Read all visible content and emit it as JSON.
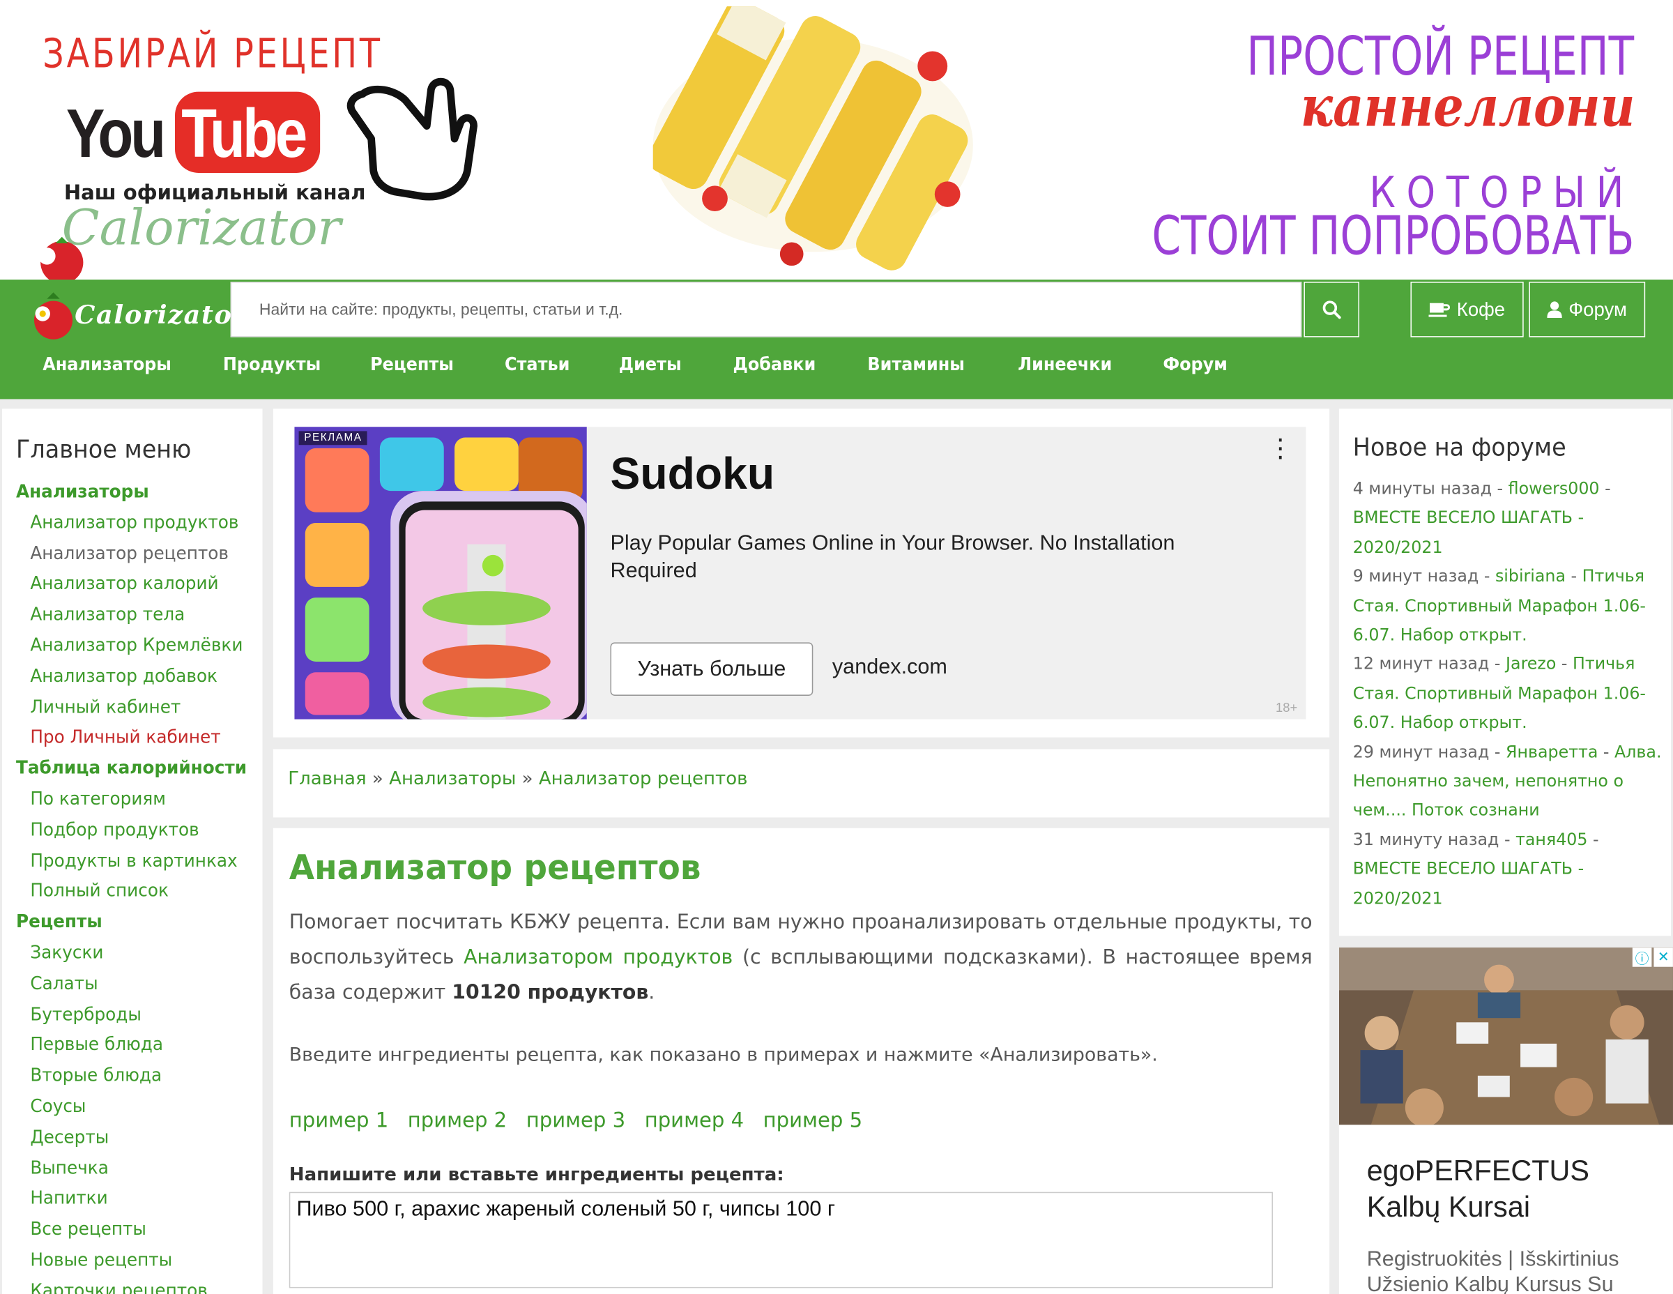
{
  "banner": {
    "left_title": "ЗАБИРАЙ РЕЦЕПТ",
    "yt_you": "You",
    "yt_tube": "Tube",
    "channel_text": "Наш официальный канал",
    "channel_script": "Calorizator",
    "right_line1": "ПРОСТОЙ РЕЦЕПТ",
    "right_line2": "каннеллони",
    "right_line3": "КОТОРЫЙ",
    "right_line4": "СТОИТ ПОПРОБОВАТЬ"
  },
  "header": {
    "logo_text": "Calorizator",
    "search_placeholder": "Найти на сайте: продукты, рецепты, статьи и т.д.",
    "coffee_label": "Кофе",
    "forum_label": "Форум"
  },
  "nav": [
    "Анализаторы",
    "Продукты",
    "Рецепты",
    "Статьи",
    "Диеты",
    "Добавки",
    "Витамины",
    "Линеечки",
    "Форум"
  ],
  "left_menu": {
    "title": "Главное меню",
    "items": [
      {
        "label": "Анализаторы",
        "kind": "cat"
      },
      {
        "label": "Анализатор продуктов",
        "kind": "sub"
      },
      {
        "label": "Анализатор рецептов",
        "kind": "sub-gray"
      },
      {
        "label": "Анализатор калорий",
        "kind": "sub"
      },
      {
        "label": "Анализатор тела",
        "kind": "sub"
      },
      {
        "label": "Анализатор Кремлёвки",
        "kind": "sub"
      },
      {
        "label": "Анализатор добавок",
        "kind": "sub"
      },
      {
        "label": "Личный кабинет",
        "kind": "sub"
      },
      {
        "label": "Про Личный кабинет",
        "kind": "sub-red"
      },
      {
        "label": "Таблица калорийности",
        "kind": "cat"
      },
      {
        "label": "По категориям",
        "kind": "sub"
      },
      {
        "label": "Подбор продуктов",
        "kind": "sub"
      },
      {
        "label": "Продукты в картинках",
        "kind": "sub"
      },
      {
        "label": "Полный список",
        "kind": "sub"
      },
      {
        "label": "Рецепты",
        "kind": "cat"
      },
      {
        "label": "Закуски",
        "kind": "sub"
      },
      {
        "label": "Салаты",
        "kind": "sub"
      },
      {
        "label": "Бутерброды",
        "kind": "sub"
      },
      {
        "label": "Первые блюда",
        "kind": "sub"
      },
      {
        "label": "Вторые блюда",
        "kind": "sub"
      },
      {
        "label": "Соусы",
        "kind": "sub"
      },
      {
        "label": "Десерты",
        "kind": "sub"
      },
      {
        "label": "Выпечка",
        "kind": "sub"
      },
      {
        "label": "Напитки",
        "kind": "sub"
      },
      {
        "label": "Все рецепты",
        "kind": "sub"
      },
      {
        "label": "Новые рецепты",
        "kind": "sub"
      },
      {
        "label": "Карточки рецептов",
        "kind": "sub"
      }
    ]
  },
  "ad": {
    "badge": "РЕКЛАМА",
    "title": "Sudoku",
    "description": "Play Popular Games Online in Your Browser. No Installation Required",
    "button": "Узнать больше",
    "domain": "yandex.com",
    "age": "18+",
    "more": "⋮"
  },
  "breadcrumb": {
    "home": "Главная",
    "sep": " » ",
    "analyzers": "Анализаторы",
    "current": "Анализатор рецептов"
  },
  "main": {
    "title": "Анализатор рецептов",
    "intro_part1": "Помогает посчитать КБЖУ рецепта. Если вам нужно проанализировать отдельные продукты, то воспользуйтесь ",
    "intro_link": "Анализатором продуктов",
    "intro_part2": " (с всплывающими подсказками). В настоящее время база содержит ",
    "intro_count": "10120 продуктов",
    "intro_part3": ".",
    "instructions": "Введите ингредиенты рецепта, как показано в примерах и нажмите «Анализировать».",
    "examples": [
      "пример 1",
      "пример 2",
      "пример 3",
      "пример 4",
      "пример 5"
    ],
    "textarea_label": "Напишите или вставьте ингредиенты рецепта:",
    "textarea_value": "Пиво 500 г, арахис жареный соленый 50 г, чипсы 100 г"
  },
  "forum": {
    "title": "Новое на форуме",
    "entries": [
      {
        "time": "4 минуты назад",
        "user": "flowers000",
        "topic": "ВМЕСТЕ ВЕСЕЛО ШАГАТЬ - 2020/2021"
      },
      {
        "time": "9 минут назад",
        "user": "sibiriana",
        "topic": "Птичья Стая. Спортивный Марафон 1.06-6.07. Набор открыт."
      },
      {
        "time": "12 минут назад",
        "user": "Jarezo",
        "topic": "Птичья Стая. Спортивный Марафон 1.06-6.07. Набор открыт."
      },
      {
        "time": "29 минут назад",
        "user": "Январетта",
        "topic": "Алва. Непонятно зачем, непонятно о чем.... Поток сознани"
      },
      {
        "time": "31 минуту назад",
        "user": "таня405",
        "topic": "ВМЕСТЕ ВЕСЕЛО ШАГАТЬ - 2020/2021"
      }
    ]
  },
  "ad2": {
    "title": "egoPERFECTUS Kalbų Kursai",
    "text": "Registruokitės | Išskirtinius Užsienio Kalbų Kursus Su"
  },
  "colors": {
    "green": "#4fa63b",
    "link_green": "#3d9a2b",
    "red": "#e0322a",
    "purple": "#9b3fd6"
  }
}
